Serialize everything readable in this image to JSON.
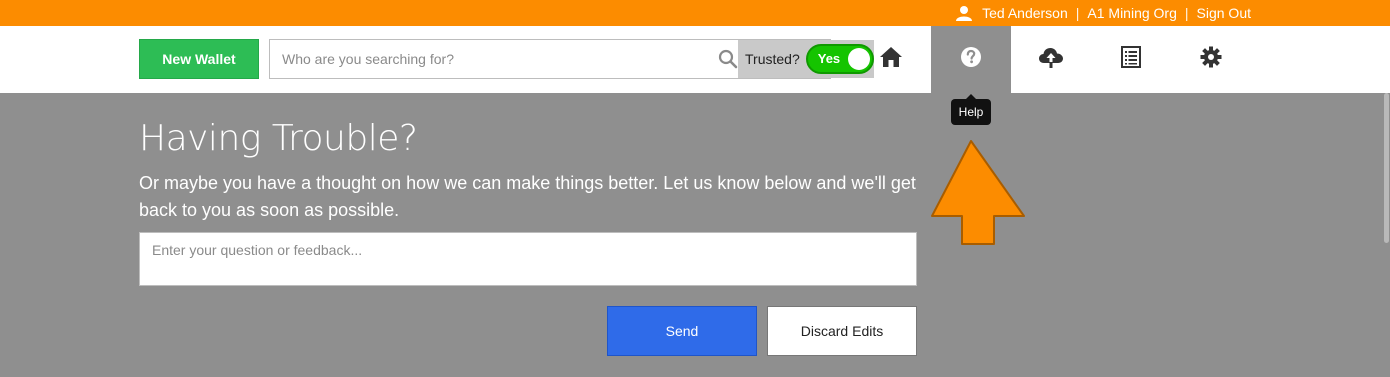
{
  "topbar": {
    "user_name": "Ted Anderson",
    "org_name": "A1 Mining Org",
    "sign_out": "Sign Out",
    "separator": "|",
    "user_icon": "user-icon"
  },
  "header": {
    "new_wallet_label": "New Wallet",
    "search": {
      "placeholder": "Who are you searching for?",
      "value": "",
      "icon": "search-icon"
    },
    "trusted": {
      "label": "Trusted?",
      "toggle_label": "Yes",
      "on": true
    },
    "nav": [
      {
        "id": "home",
        "icon": "home-icon",
        "active": false
      },
      {
        "id": "help",
        "icon": "help-icon",
        "active": true
      },
      {
        "id": "upload",
        "icon": "cloud-upload-icon",
        "active": false
      },
      {
        "id": "list",
        "icon": "list-icon",
        "active": false
      },
      {
        "id": "settings",
        "icon": "gear-icon",
        "active": false
      }
    ]
  },
  "tooltip": {
    "text": "Help"
  },
  "main": {
    "title": "Having Trouble?",
    "subtitle": "Or maybe you have a thought on how we can make things better. Let us know below and we'll get back to you as soon as possible.",
    "feedback_placeholder": "Enter your question or feedback...",
    "send_label": "Send",
    "discard_label": "Discard Edits"
  },
  "colors": {
    "topbar": "#fc8c00",
    "accent_green": "#2dbd55",
    "toggle_green": "#15c400",
    "send_blue": "#2f6be9",
    "page_bg": "#8f8f8f",
    "arrow": "#fc8c00"
  }
}
